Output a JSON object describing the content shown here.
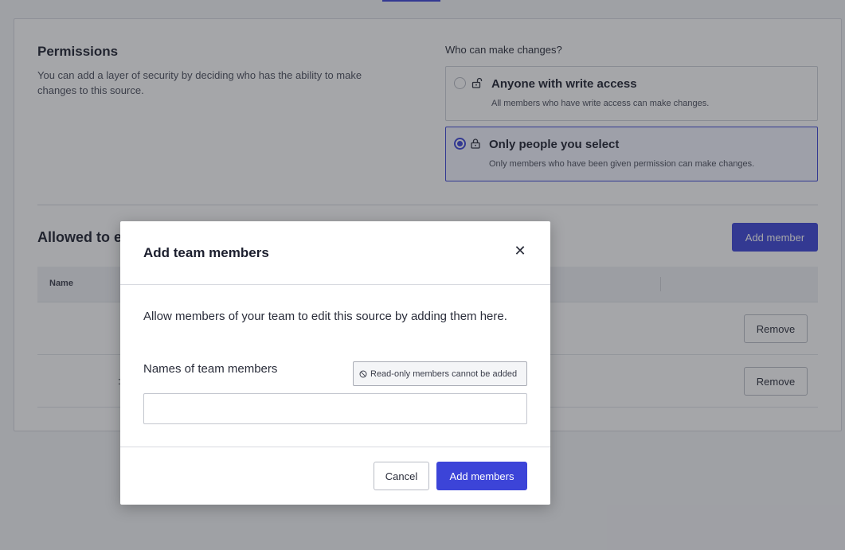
{
  "permissions": {
    "title": "Permissions",
    "description": "You can add a layer of security by deciding who has the ability to make changes to this source.",
    "who_label": "Who can make changes?",
    "options": [
      {
        "title": "Anyone with write access",
        "subtitle": "All members who have write access can make changes.",
        "selected": false,
        "icon": "unlock-icon"
      },
      {
        "title": "Only people you select",
        "subtitle": "Only members who have been given permission can make changes.",
        "selected": true,
        "icon": "lock-icon"
      }
    ]
  },
  "allowed": {
    "title": "Allowed to e",
    "add_member_label": "Add member",
    "table": {
      "headers": [
        "Name"
      ],
      "rows": [
        {
          "name_fragment": "",
          "remove_label": "Remove"
        },
        {
          "name_fragment": ":",
          "remove_label": "Remove"
        }
      ]
    }
  },
  "modal": {
    "title": "Add team members",
    "close_icon": "close-icon",
    "description": "Allow members of your team to edit this source by adding them here.",
    "field_label": "Names of team members",
    "readonly_notice": "Read-only members cannot be added",
    "input_value": "",
    "cancel_label": "Cancel",
    "submit_label": "Add members"
  },
  "colors": {
    "accent": "#3c44d8",
    "selected_bg": "#f3f5ff"
  }
}
